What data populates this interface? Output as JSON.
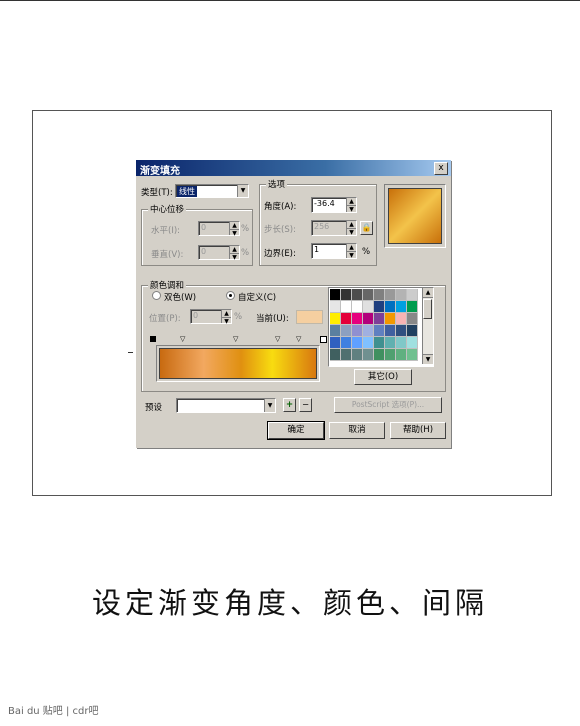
{
  "dialog": {
    "title": "渐变填充",
    "close_glyph": "x",
    "type": {
      "label": "类型(T):",
      "value": "线性"
    },
    "center_group": {
      "caption": "中心位移",
      "horizontal": {
        "label": "水平(I):",
        "value": "0",
        "unit": "%"
      },
      "vertical": {
        "label": "垂直(V):",
        "value": "0",
        "unit": "%"
      }
    },
    "options_group": {
      "caption": "选项",
      "angle": {
        "label": "角度(A):",
        "value": "-36.4"
      },
      "steps": {
        "label": "步长(S):",
        "value": "256"
      },
      "edge": {
        "label": "边界(E):",
        "value": "1",
        "unit": "%"
      }
    },
    "blend_group": {
      "caption": "颜色调和",
      "two_color": "双色(W)",
      "custom": "自定义(C)",
      "selected_mode": "custom",
      "position": {
        "label": "位置(P):",
        "value": "0",
        "unit": "%"
      },
      "current": {
        "label": "当前(U):",
        "color": "#f5cfa0"
      },
      "gradient_stops": [
        {
          "offset": 0.0,
          "color": "#c86a10"
        },
        {
          "offset": 0.28,
          "color": "#f2a860"
        },
        {
          "offset": 0.52,
          "color": "#e09010"
        },
        {
          "offset": 0.72,
          "color": "#f8dc10"
        },
        {
          "offset": 1.0,
          "color": "#d87810"
        }
      ],
      "other_button": "其它(O)"
    },
    "palette": {
      "colors": [
        [
          "#000000",
          "#333333",
          "#4d4d4d",
          "#666666",
          "#808080",
          "#999999",
          "#b3b3b3",
          "#cccccc"
        ],
        [
          "#e6e6e6",
          "#ffffff",
          "#ffffff",
          "#e0e0e0",
          "#1f3f7f",
          "#0070c0",
          "#00a0e0",
          "#009b4e"
        ],
        [
          "#ffed00",
          "#e4003a",
          "#e6007e",
          "#b2007c",
          "#7f3f98",
          "#f39800",
          "#f8b4b4",
          "#888888"
        ],
        [
          "#5a7fa0",
          "#8ca0c0",
          "#9090d0",
          "#a0b0e0",
          "#6080c0",
          "#4060a0",
          "#305080",
          "#204060"
        ],
        [
          "#3060c0",
          "#4080e0",
          "#60a0ff",
          "#80c0ff",
          "#409090",
          "#60b0b0",
          "#80c8c8",
          "#a0e0e0"
        ],
        [
          "#406060",
          "#507070",
          "#608080",
          "#709090",
          "#409060",
          "#50a070",
          "#60b080",
          "#70c090"
        ]
      ]
    },
    "preset": {
      "label": "预设",
      "value": "",
      "add": "+",
      "remove": "−",
      "postscript": "PostScript 选项(P)..."
    },
    "ok": "确定",
    "cancel": "取消",
    "help": "帮助(H)",
    "preview": {
      "from": "#f3c34a",
      "to": "#c8700a"
    }
  },
  "caption": "设定渐变角度、颜色、间隔",
  "watermark": "Bai du 贴吧 | cdr吧"
}
